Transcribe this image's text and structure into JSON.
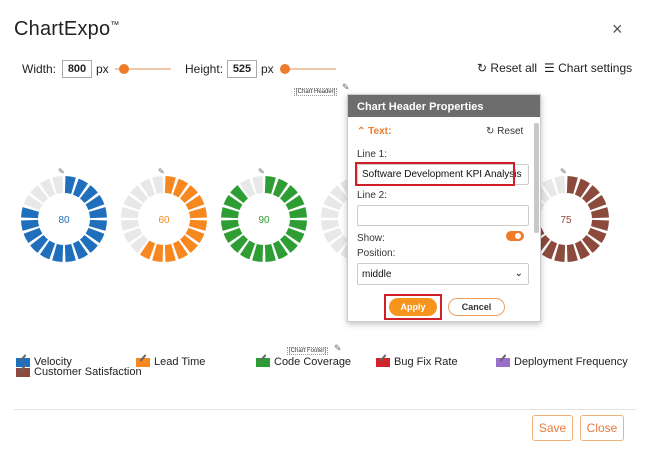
{
  "app": {
    "title": "ChartExpo",
    "trademark": "™",
    "close_glyph": "×"
  },
  "toolbar": {
    "width_label": "Width:",
    "width_value": "800",
    "width_unit": "px",
    "height_label": "Height:",
    "height_value": "525",
    "height_unit": "px",
    "reset_all": "Reset all",
    "chart_settings": "Chart settings"
  },
  "chart": {
    "header_placeholder": "[Chart Header]",
    "footer_placeholder": "[Chart Footer]",
    "donuts": [
      {
        "label": "80",
        "value": 80,
        "color": "#1f6fbd"
      },
      {
        "label": "60",
        "value": 60,
        "color": "#f7871f"
      },
      {
        "label": "90",
        "value": 90,
        "color": "#2e9e34"
      },
      {
        "label": "",
        "value": 30,
        "color": "#d3232a"
      },
      {
        "label": "75",
        "value": 75,
        "color": "#8b4a3c"
      }
    ],
    "empty_color": "#e8e8e8",
    "legend": [
      {
        "label": "Velocity",
        "color": "#1f6fbd"
      },
      {
        "label": "Lead Time",
        "color": "#f7871f"
      },
      {
        "label": "Code Coverage",
        "color": "#2e9e34"
      },
      {
        "label": "Bug Fix Rate",
        "color": "#d3232a"
      },
      {
        "label": "Deployment Frequency",
        "color": "#9b6ec9"
      },
      {
        "label": "Customer Satisfaction",
        "color": "#8b4a3c"
      }
    ]
  },
  "panel": {
    "title": "Chart Header Properties",
    "section": "Text:",
    "reset": "Reset",
    "line1_label": "Line 1:",
    "line1_value": "Software Development KPI Analysis",
    "line2_label": "Line 2:",
    "line2_value": "",
    "show_label": "Show:",
    "show_value": true,
    "position_label": "Position:",
    "position_value": "middle",
    "apply": "Apply",
    "cancel": "Cancel"
  },
  "footer": {
    "save": "Save",
    "close": "Close"
  },
  "colors": {
    "accent": "#ee7a2a",
    "highlight": "#d11f2a"
  }
}
